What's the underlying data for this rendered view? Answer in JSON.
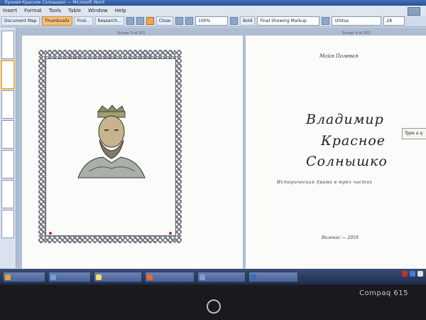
{
  "window": {
    "title": "Лунная Красное Солнышко — Microsoft Word"
  },
  "menu": [
    "Insert",
    "Format",
    "Tools",
    "Table",
    "Window",
    "Help"
  ],
  "toolbar": {
    "left_btn1": "Document Map",
    "left_btn2": "Thumbnails",
    "find": "Find...",
    "research": "Research...",
    "close": "Close",
    "zoom": "100%",
    "bold": "Bold",
    "markup": "Final Showing Markup",
    "font": "Izhitsa",
    "size": "28"
  },
  "pages": {
    "left_label": "Screen 3 of 351",
    "right_label": "Screen 4 of 351"
  },
  "book": {
    "author": "Майя Полевая",
    "title_line1": "Владимир",
    "title_line2": "Красное",
    "title_line3": "Солнышко",
    "subtitle": "Историческая драма в трех частях",
    "publisher": "Виленос — 2010"
  },
  "tooltip": "Type a q",
  "taskbar": {
    "items": [
      "",
      "",
      "",
      "",
      "",
      ""
    ]
  },
  "bezel": {
    "brand": "Compaq 615"
  },
  "colors": {
    "accent": "#f2a24c",
    "taskbar": "#1f2d4e",
    "page": "#fbfbf9"
  }
}
